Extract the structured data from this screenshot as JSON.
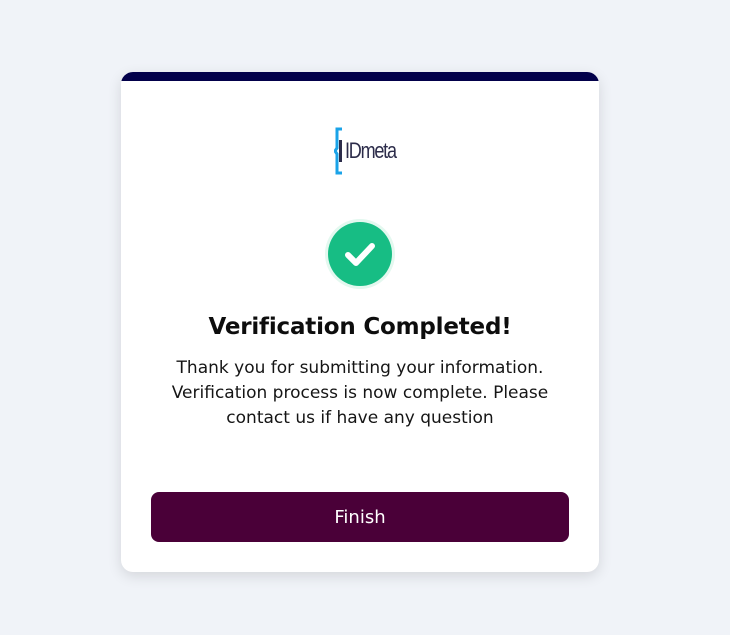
{
  "logo": {
    "text": "IDmeta",
    "brand_color": "#2c2c4a",
    "mark_color": "#1aa3e8"
  },
  "status": {
    "icon": "check-icon",
    "color": "#17bd84"
  },
  "card": {
    "title": "Verification Completed!",
    "message": "Thank you for submitting your information. Verification process is now complete. Please contact us if have any question",
    "accent_color": "#02004a"
  },
  "actions": {
    "finish_label": "Finish",
    "finish_color": "#4a0038"
  }
}
